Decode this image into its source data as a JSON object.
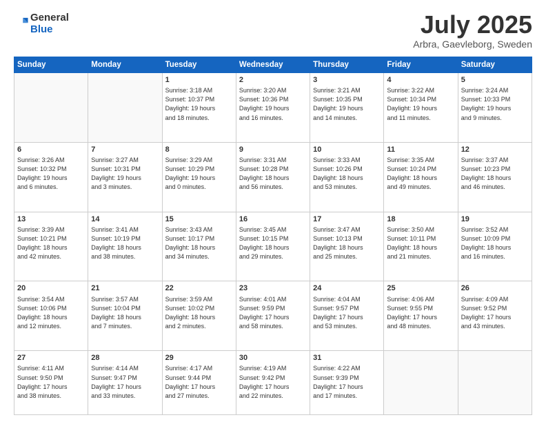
{
  "header": {
    "logo_line1": "General",
    "logo_line2": "Blue",
    "month": "July 2025",
    "location": "Arbra, Gaevleborg, Sweden"
  },
  "weekdays": [
    "Sunday",
    "Monday",
    "Tuesday",
    "Wednesday",
    "Thursday",
    "Friday",
    "Saturday"
  ],
  "weeks": [
    [
      {
        "day": "",
        "info": ""
      },
      {
        "day": "",
        "info": ""
      },
      {
        "day": "1",
        "info": "Sunrise: 3:18 AM\nSunset: 10:37 PM\nDaylight: 19 hours\nand 18 minutes."
      },
      {
        "day": "2",
        "info": "Sunrise: 3:20 AM\nSunset: 10:36 PM\nDaylight: 19 hours\nand 16 minutes."
      },
      {
        "day": "3",
        "info": "Sunrise: 3:21 AM\nSunset: 10:35 PM\nDaylight: 19 hours\nand 14 minutes."
      },
      {
        "day": "4",
        "info": "Sunrise: 3:22 AM\nSunset: 10:34 PM\nDaylight: 19 hours\nand 11 minutes."
      },
      {
        "day": "5",
        "info": "Sunrise: 3:24 AM\nSunset: 10:33 PM\nDaylight: 19 hours\nand 9 minutes."
      }
    ],
    [
      {
        "day": "6",
        "info": "Sunrise: 3:26 AM\nSunset: 10:32 PM\nDaylight: 19 hours\nand 6 minutes."
      },
      {
        "day": "7",
        "info": "Sunrise: 3:27 AM\nSunset: 10:31 PM\nDaylight: 19 hours\nand 3 minutes."
      },
      {
        "day": "8",
        "info": "Sunrise: 3:29 AM\nSunset: 10:29 PM\nDaylight: 19 hours\nand 0 minutes."
      },
      {
        "day": "9",
        "info": "Sunrise: 3:31 AM\nSunset: 10:28 PM\nDaylight: 18 hours\nand 56 minutes."
      },
      {
        "day": "10",
        "info": "Sunrise: 3:33 AM\nSunset: 10:26 PM\nDaylight: 18 hours\nand 53 minutes."
      },
      {
        "day": "11",
        "info": "Sunrise: 3:35 AM\nSunset: 10:24 PM\nDaylight: 18 hours\nand 49 minutes."
      },
      {
        "day": "12",
        "info": "Sunrise: 3:37 AM\nSunset: 10:23 PM\nDaylight: 18 hours\nand 46 minutes."
      }
    ],
    [
      {
        "day": "13",
        "info": "Sunrise: 3:39 AM\nSunset: 10:21 PM\nDaylight: 18 hours\nand 42 minutes."
      },
      {
        "day": "14",
        "info": "Sunrise: 3:41 AM\nSunset: 10:19 PM\nDaylight: 18 hours\nand 38 minutes."
      },
      {
        "day": "15",
        "info": "Sunrise: 3:43 AM\nSunset: 10:17 PM\nDaylight: 18 hours\nand 34 minutes."
      },
      {
        "day": "16",
        "info": "Sunrise: 3:45 AM\nSunset: 10:15 PM\nDaylight: 18 hours\nand 29 minutes."
      },
      {
        "day": "17",
        "info": "Sunrise: 3:47 AM\nSunset: 10:13 PM\nDaylight: 18 hours\nand 25 minutes."
      },
      {
        "day": "18",
        "info": "Sunrise: 3:50 AM\nSunset: 10:11 PM\nDaylight: 18 hours\nand 21 minutes."
      },
      {
        "day": "19",
        "info": "Sunrise: 3:52 AM\nSunset: 10:09 PM\nDaylight: 18 hours\nand 16 minutes."
      }
    ],
    [
      {
        "day": "20",
        "info": "Sunrise: 3:54 AM\nSunset: 10:06 PM\nDaylight: 18 hours\nand 12 minutes."
      },
      {
        "day": "21",
        "info": "Sunrise: 3:57 AM\nSunset: 10:04 PM\nDaylight: 18 hours\nand 7 minutes."
      },
      {
        "day": "22",
        "info": "Sunrise: 3:59 AM\nSunset: 10:02 PM\nDaylight: 18 hours\nand 2 minutes."
      },
      {
        "day": "23",
        "info": "Sunrise: 4:01 AM\nSunset: 9:59 PM\nDaylight: 17 hours\nand 58 minutes."
      },
      {
        "day": "24",
        "info": "Sunrise: 4:04 AM\nSunset: 9:57 PM\nDaylight: 17 hours\nand 53 minutes."
      },
      {
        "day": "25",
        "info": "Sunrise: 4:06 AM\nSunset: 9:55 PM\nDaylight: 17 hours\nand 48 minutes."
      },
      {
        "day": "26",
        "info": "Sunrise: 4:09 AM\nSunset: 9:52 PM\nDaylight: 17 hours\nand 43 minutes."
      }
    ],
    [
      {
        "day": "27",
        "info": "Sunrise: 4:11 AM\nSunset: 9:50 PM\nDaylight: 17 hours\nand 38 minutes."
      },
      {
        "day": "28",
        "info": "Sunrise: 4:14 AM\nSunset: 9:47 PM\nDaylight: 17 hours\nand 33 minutes."
      },
      {
        "day": "29",
        "info": "Sunrise: 4:17 AM\nSunset: 9:44 PM\nDaylight: 17 hours\nand 27 minutes."
      },
      {
        "day": "30",
        "info": "Sunrise: 4:19 AM\nSunset: 9:42 PM\nDaylight: 17 hours\nand 22 minutes."
      },
      {
        "day": "31",
        "info": "Sunrise: 4:22 AM\nSunset: 9:39 PM\nDaylight: 17 hours\nand 17 minutes."
      },
      {
        "day": "",
        "info": ""
      },
      {
        "day": "",
        "info": ""
      }
    ]
  ]
}
